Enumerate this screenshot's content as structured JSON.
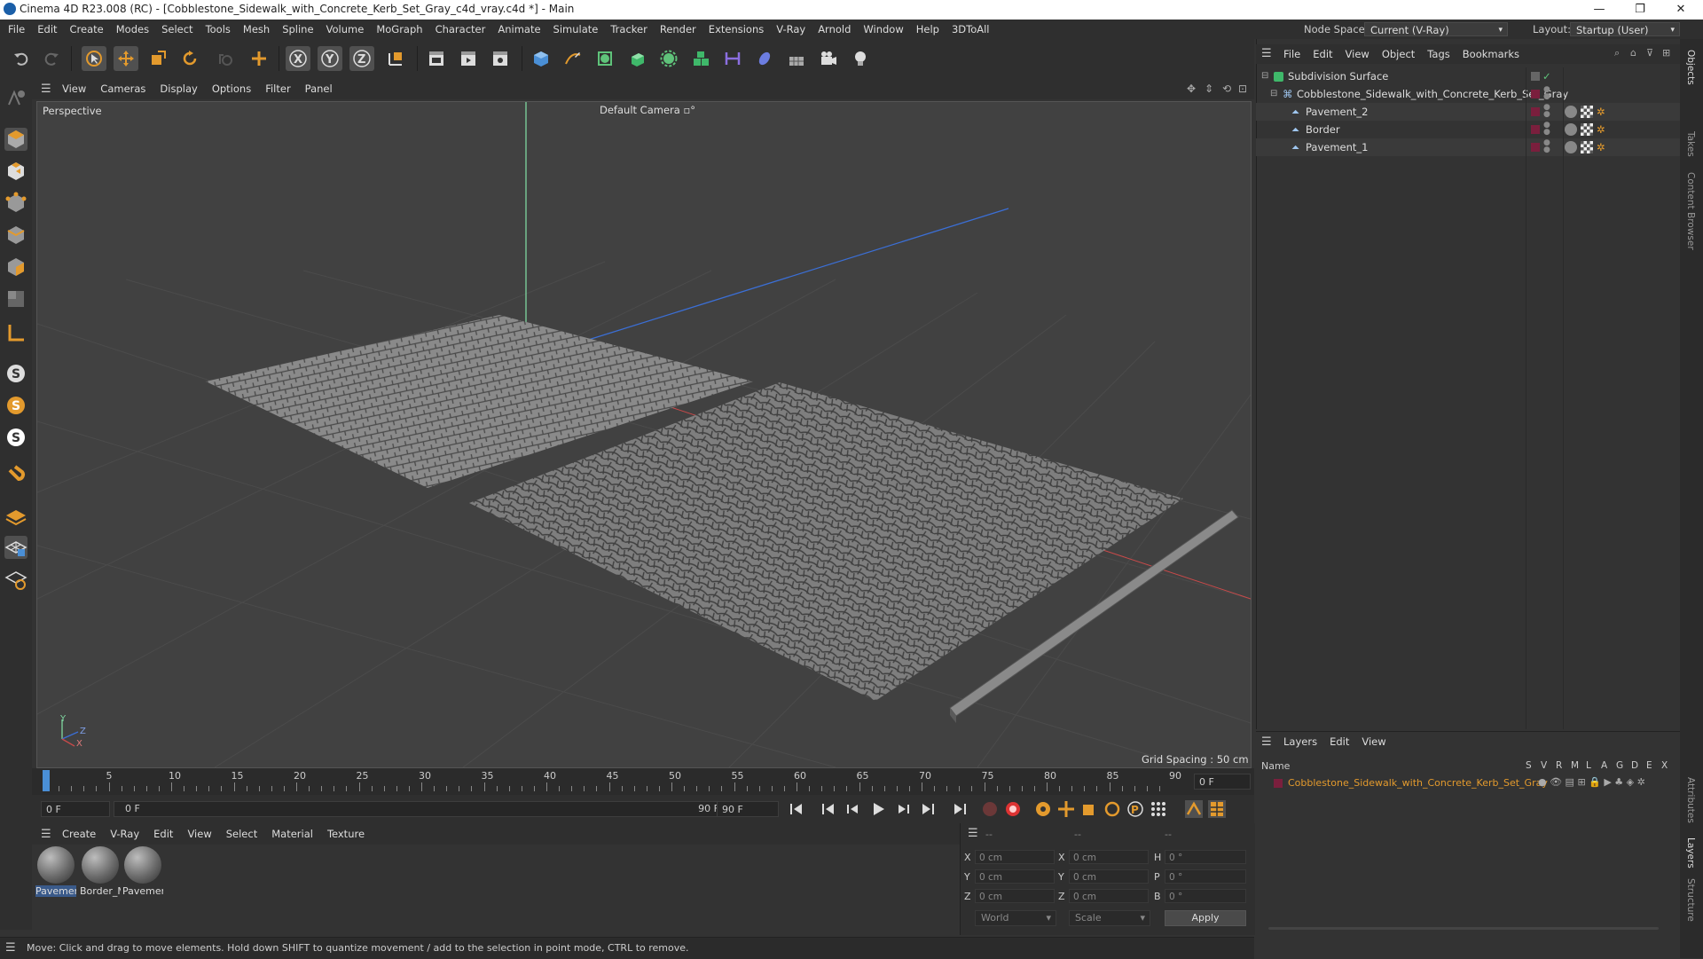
{
  "window": {
    "title": "Cinema 4D R23.008 (RC) - [Cobblestone_Sidewalk_with_Concrete_Kerb_Set_Gray_c4d_vray.c4d *] - Main",
    "controls": [
      "—",
      "❐",
      "✕"
    ]
  },
  "menubar": {
    "items": [
      "File",
      "Edit",
      "Create",
      "Modes",
      "Select",
      "Tools",
      "Mesh",
      "Spline",
      "Volume",
      "MoGraph",
      "Character",
      "Animate",
      "Simulate",
      "Tracker",
      "Render",
      "Extensions",
      "V-Ray",
      "Arnold",
      "Window",
      "Help",
      "3DToAll"
    ],
    "node_space_label": "Node Space:",
    "node_space_value": "Current (V-Ray)",
    "layout_label": "Layout:",
    "layout_value": "Startup (User)"
  },
  "viewport": {
    "menu": [
      "View",
      "Cameras",
      "Display",
      "Options",
      "Filter",
      "Panel"
    ],
    "label": "Perspective",
    "camera": "Default Camera",
    "grid_spacing": "Grid Spacing : 50 cm",
    "axis_labels": {
      "y": "Y",
      "z": "Z",
      "x": "X"
    }
  },
  "timeline": {
    "ticks": [
      "0",
      "5",
      "10",
      "15",
      "20",
      "25",
      "30",
      "35",
      "40",
      "45",
      "50",
      "55",
      "60",
      "65",
      "70",
      "75",
      "80",
      "85",
      "90"
    ],
    "current_frame": "0 F",
    "start_field": "0 F",
    "range_start": "0 F",
    "range_end": "90 F",
    "end_field": "90 F"
  },
  "material_manager": {
    "menu": [
      "Create",
      "V-Ray",
      "Edit",
      "View",
      "Select",
      "Material",
      "Texture"
    ],
    "materials": [
      "Pavemen",
      "Border_M",
      "Pavemen"
    ]
  },
  "coordinates": {
    "headers": [
      "--",
      "--",
      "--"
    ],
    "rows": [
      {
        "axis": "X",
        "pos": "0 cm",
        "axis2": "X",
        "size": "0 cm",
        "axis3": "H",
        "rot": "0 °"
      },
      {
        "axis": "Y",
        "pos": "0 cm",
        "axis2": "Y",
        "size": "0 cm",
        "axis3": "P",
        "rot": "0 °"
      },
      {
        "axis": "Z",
        "pos": "0 cm",
        "axis2": "Z",
        "size": "0 cm",
        "axis3": "B",
        "rot": "0 °"
      }
    ],
    "mode1": "World",
    "mode2": "Scale",
    "apply_label": "Apply"
  },
  "status": {
    "text": "Move: Click and drag to move elements. Hold down SHIFT to quantize movement / add to the selection in point mode, CTRL to remove."
  },
  "object_manager": {
    "menu": [
      "File",
      "Edit",
      "View",
      "Object",
      "Tags",
      "Bookmarks"
    ],
    "objects": [
      {
        "name": "Subdivision Surface"
      },
      {
        "name": "Cobblestone_Sidewalk_with_Concrete_Kerb_Set_Gray"
      },
      {
        "name": "Pavement_2"
      },
      {
        "name": "Border"
      },
      {
        "name": "Pavement_1"
      }
    ]
  },
  "layer_manager": {
    "menu": [
      "Layers",
      "Edit",
      "View"
    ],
    "name_header": "Name",
    "columns": [
      "S",
      "V",
      "R",
      "M",
      "L",
      "A",
      "G",
      "D",
      "E",
      "X"
    ],
    "layers": [
      {
        "name": "Cobblestone_Sidewalk_with_Concrete_Kerb_Set_Gray",
        "color": "#7a1f3d"
      }
    ]
  },
  "side_tabs": [
    "Objects",
    "Takes",
    "Content Browser",
    "Attributes",
    "Layers",
    "Structure"
  ],
  "colors": {
    "accent_blue": "#4a8fd6",
    "orange": "#e39a2d",
    "layer_text": "#e39a2d",
    "axis_green": "#7fd6a0",
    "axis_blue": "#3b6fd6",
    "axis_red": "#c84a4a"
  }
}
